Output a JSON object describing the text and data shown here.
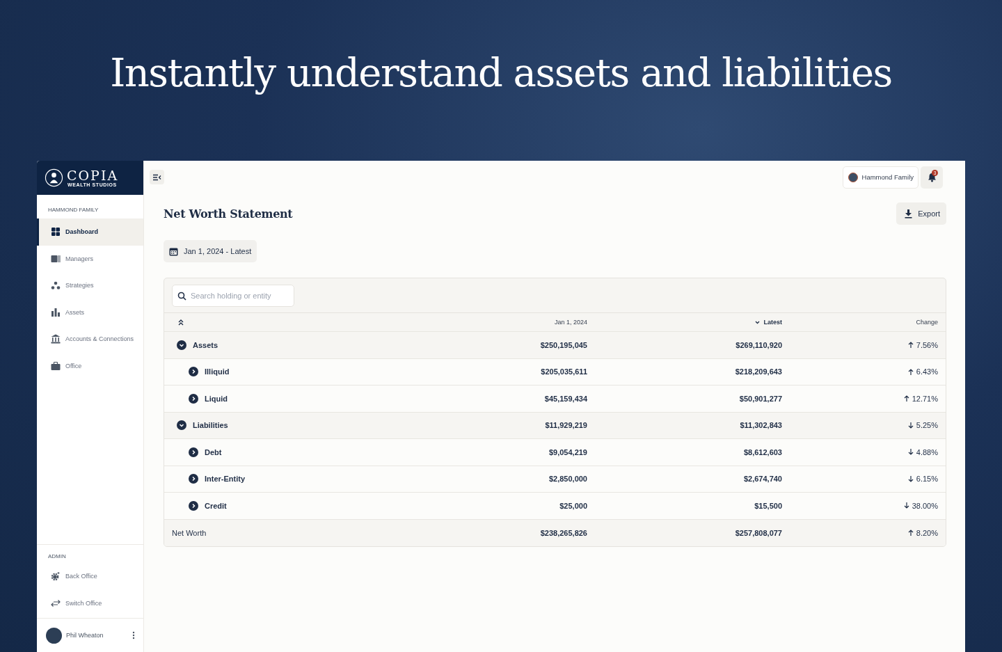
{
  "headline": "Instantly understand assets and liabilities",
  "brand": {
    "name": "COPIA",
    "tagline": "WEALTH STUDIOS"
  },
  "sidebar": {
    "section": "HAMMOND FAMILY",
    "items": [
      {
        "label": "Dashboard",
        "selected": true
      },
      {
        "label": "Managers",
        "selected": false
      },
      {
        "label": "Strategies",
        "selected": false
      },
      {
        "label": "Assets",
        "selected": false
      },
      {
        "label": "Accounts & Connections",
        "selected": false
      },
      {
        "label": "Office",
        "selected": false
      }
    ],
    "admin_section": "ADMIN",
    "admin_items": [
      {
        "label": "Back Office",
        "selected": false
      },
      {
        "label": "Switch Office",
        "selected": false
      }
    ],
    "user": "Phil Wheaton"
  },
  "topbar": {
    "family": "Hammond Family",
    "notifications": "3"
  },
  "page": {
    "title": "Net Worth Statement",
    "export": "Export",
    "date_range": "Jan 1, 2024 - Latest"
  },
  "table": {
    "search_placeholder": "Search holding or entity",
    "columns": [
      {
        "label": "Jan 1, 2024",
        "sorted": false
      },
      {
        "label": "Latest",
        "sorted": true
      },
      {
        "label": "Change",
        "sorted": false
      }
    ],
    "rows": [
      {
        "name": "Assets",
        "start": "$250,195,045",
        "latest": "$269,110,920",
        "change": "7.56%",
        "kind": "up",
        "expanded": true,
        "children": [
          {
            "name": "Illiquid",
            "start": "$205,035,611",
            "latest": "$218,209,643",
            "change": "6.43%",
            "kind": "up",
            "expanded": false
          },
          {
            "name": "Liquid",
            "start": "$45,159,434",
            "latest": "$50,901,277",
            "change": "12.71%",
            "kind": "up",
            "expanded": false
          }
        ]
      },
      {
        "name": "Liabilities",
        "start": "$11,929,219",
        "latest": "$11,302,843",
        "change": "5.25%",
        "kind": "down",
        "expanded": true,
        "children": [
          {
            "name": "Debt",
            "start": "$9,054,219",
            "latest": "$8,612,603",
            "change": "4.88%",
            "kind": "down",
            "expanded": false
          },
          {
            "name": "Inter-Entity",
            "start": "$2,850,000",
            "latest": "$2,674,740",
            "change": "6.15%",
            "kind": "down",
            "expanded": false
          },
          {
            "name": "Credit",
            "start": "$25,000",
            "latest": "$15,500",
            "change": "38.00%",
            "kind": "down",
            "expanded": false
          }
        ]
      }
    ],
    "total": {
      "name": "Net Worth",
      "start": "$238,265,826",
      "latest": "$257,808,077",
      "change": "8.20%",
      "kind": "up"
    }
  }
}
